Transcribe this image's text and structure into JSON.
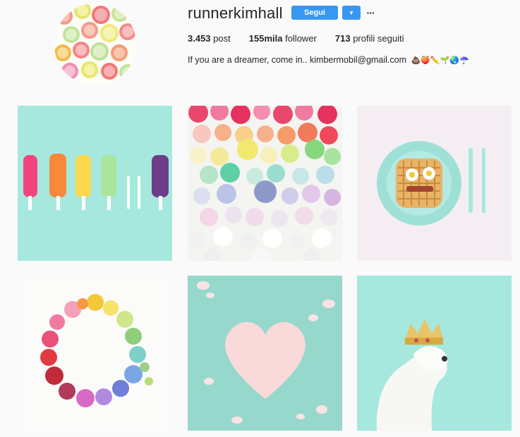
{
  "profile": {
    "username": "runnerkimhall",
    "follow_label": "Segui",
    "dropdown_glyph": "▼",
    "more_glyph": "···",
    "stats": {
      "posts_count": "3.453",
      "posts_label": "post",
      "followers_count": "155mila",
      "followers_label": "follower",
      "following_count": "713",
      "following_label": "profili seguiti"
    },
    "bio": "If you are a dreamer, come in.. kimbermobil@gmail.com",
    "bio_emojis": "💩🍑✏️🌱🌏☂️"
  },
  "colors": {
    "accent": "#3897f0",
    "mint": "#a6e8de",
    "background": "#fafafa"
  },
  "posts": [
    {
      "subject": "popsicles"
    },
    {
      "subject": "buttons"
    },
    {
      "subject": "waffle"
    },
    {
      "subject": "flower-wreath"
    },
    {
      "subject": "petal-heart"
    },
    {
      "subject": "dog-with-crown"
    }
  ]
}
